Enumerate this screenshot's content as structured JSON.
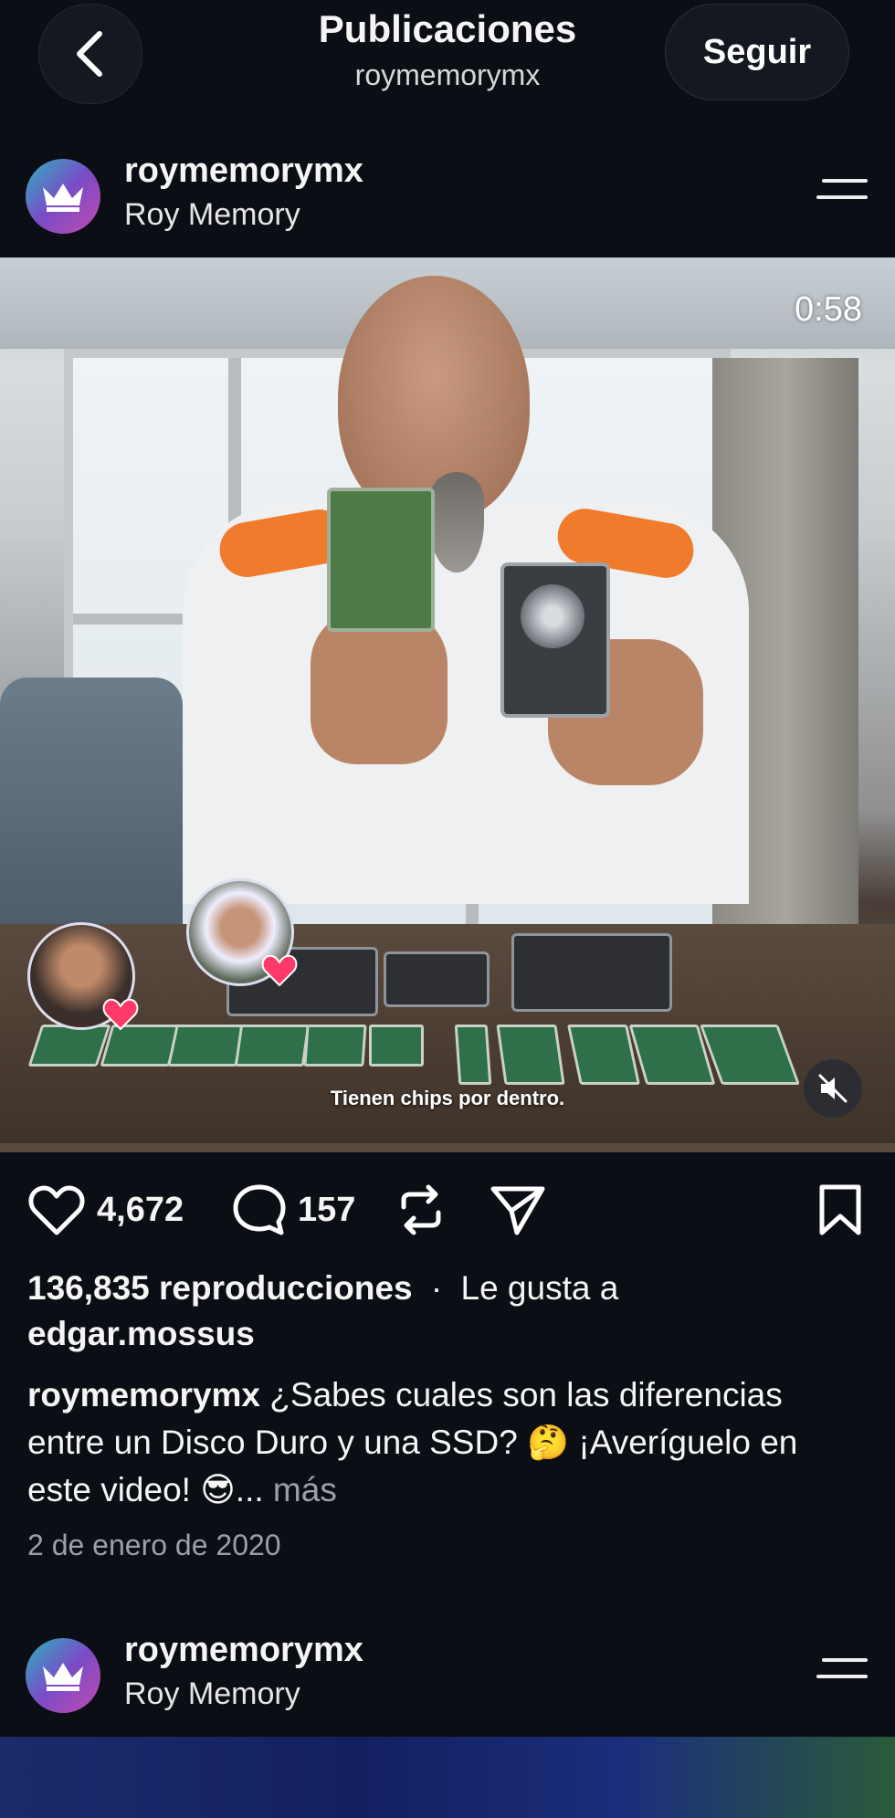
{
  "header": {
    "title": "Publicaciones",
    "subtitle": "roymemorymx",
    "follow_label": "Seguir"
  },
  "post": {
    "username": "roymemorymx",
    "fullname": "Roy Memory",
    "video": {
      "duration": "0:58",
      "overlay_caption": "Tienen chips por dentro."
    },
    "likes": "4,672",
    "comments": "157",
    "views_text": "136,835 reproducciones",
    "separator": "·",
    "liked_by_prefix": "Le gusta a",
    "liked_by_user": "edgar.mossus",
    "caption_user": "roymemorymx",
    "caption_text": "¿Sabes cuales son las diferencias entre un Disco Duro y una SSD? 🤔 ¡Averíguelo en este video! 😎...",
    "more_label": "más",
    "date": "2 de enero de 2020"
  },
  "next_post": {
    "username": "roymemorymx",
    "fullname": "Roy Memory"
  },
  "colors": {
    "background": "#0b0e14",
    "text": "#f5f5f5",
    "muted": "#9aa0aa",
    "heart_badge": "#ff3a6a"
  },
  "icons": [
    "back-chevron-icon",
    "menu-icon",
    "like-heart-icon",
    "comment-icon",
    "repost-icon",
    "share-icon",
    "bookmark-icon",
    "mute-icon",
    "crown-logo-icon"
  ]
}
